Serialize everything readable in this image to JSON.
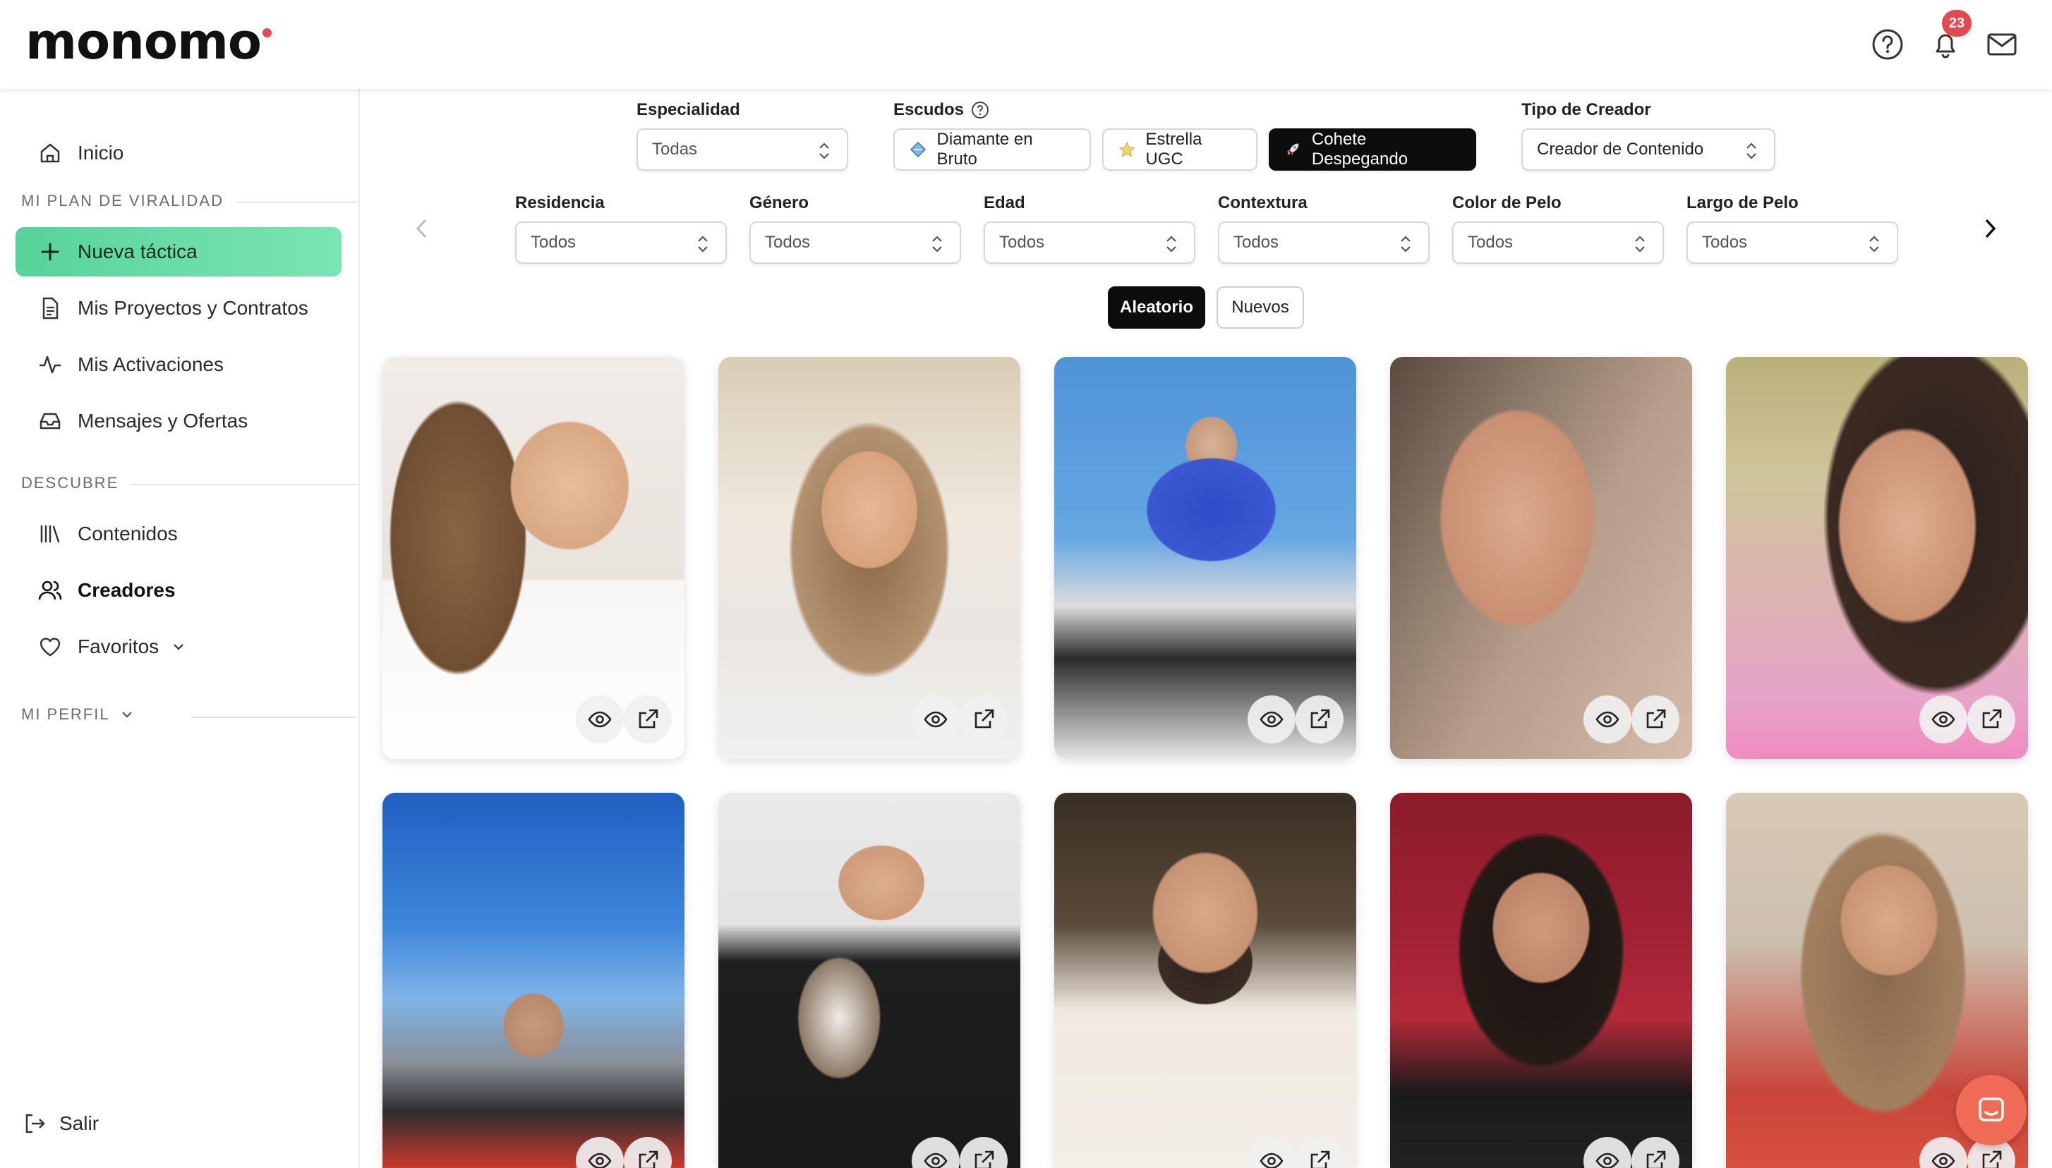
{
  "brand": {
    "logo_text": "monomo"
  },
  "header": {
    "notification_count": "23"
  },
  "sidebar": {
    "inicio": "Inicio",
    "section_plan": "MI PLAN DE VIRALIDAD",
    "nueva_tactica": "Nueva táctica",
    "proyectos": "Mis Proyectos y Contratos",
    "activaciones": "Mis Activaciones",
    "mensajes": "Mensajes y Ofertas",
    "section_descubre": "DESCUBRE",
    "contenidos": "Contenidos",
    "creadores": "Creadores",
    "favoritos": "Favoritos",
    "section_perfil": "MI PERFIL",
    "salir": "Salir"
  },
  "filters": {
    "especialidad": {
      "label": "Especialidad",
      "value": "Todas"
    },
    "escudos": {
      "label": "Escudos",
      "options": [
        "Diamante en Bruto",
        "Estrella UGC",
        "Cohete Despegando"
      ],
      "active": "Cohete Despegando"
    },
    "tipo_creador": {
      "label": "Tipo de Creador",
      "value": "Creador de Contenido"
    },
    "residencia": {
      "label": "Residencia",
      "value": "Todos"
    },
    "genero": {
      "label": "Género",
      "value": "Todos"
    },
    "edad": {
      "label": "Edad",
      "value": "Todos"
    },
    "contextura": {
      "label": "Contextura",
      "value": "Todos"
    },
    "color_pelo": {
      "label": "Color de Pelo",
      "value": "Todos"
    },
    "largo_pelo": {
      "label": "Largo de Pelo",
      "value": "Todos"
    }
  },
  "sort": {
    "aleatorio": "Aleatorio",
    "nuevos": "Nuevos",
    "active": "Aleatorio"
  },
  "colors": {
    "accent_green": "#56d49a",
    "badge_red": "#e5484d",
    "fab_orange": "#ef6b55"
  }
}
